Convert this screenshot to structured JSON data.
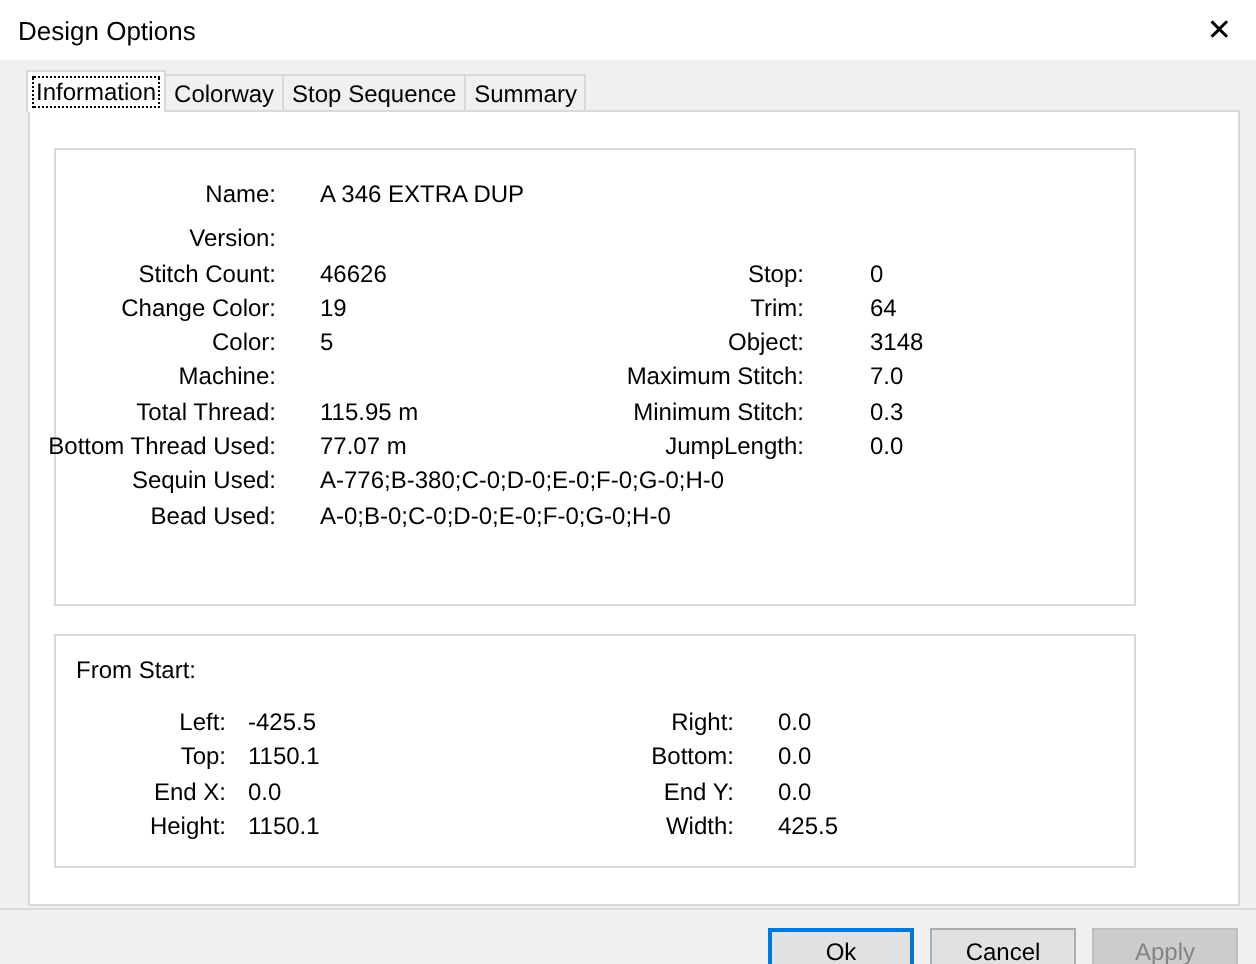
{
  "window": {
    "title": "Design Options",
    "close": "✕"
  },
  "tabs": [
    {
      "label": "Information",
      "selected": true
    },
    {
      "label": "Colorway",
      "selected": false
    },
    {
      "label": "Stop Sequence",
      "selected": false
    },
    {
      "label": "Summary",
      "selected": false
    }
  ],
  "information": {
    "rows": [
      {
        "label": "Name:",
        "value": "A 346 EXTRA DUP"
      },
      {
        "label": "Version:"
      },
      {
        "label": "Stitch Count:",
        "value": "46626",
        "stat_label": "Stop:",
        "stat_value": "0"
      },
      {
        "label": "Change Color:",
        "value": "19",
        "stat_label": "Trim:",
        "stat_value": "64"
      },
      {
        "label": "Color:",
        "value": "5",
        "stat_label": "Object:",
        "stat_value": "3148"
      },
      {
        "label": "Machine:",
        "stat_label": "Maximum Stitch:",
        "stat_value": "7.0"
      },
      {
        "label": "Total Thread:",
        "value": "115.95 m",
        "stat_label": "Minimum Stitch:",
        "stat_value": "0.3"
      },
      {
        "label": "Bottom Thread Used:",
        "value": "77.07 m",
        "stat_label": "JumpLength:",
        "stat_value": "0.0"
      },
      {
        "label": "Sequin Used:",
        "value": "A-776;B-380;C-0;D-0;E-0;F-0;G-0;H-0"
      },
      {
        "label": "Bead Used:",
        "value": "A-0;B-0;C-0;D-0;E-0;F-0;G-0;H-0"
      }
    ]
  },
  "from_start": {
    "heading": "From Start:",
    "rows": [
      {
        "label": "Left:",
        "value": "-425.5",
        "stat_label": "Right:",
        "stat_value": "0.0"
      },
      {
        "label": "Top:",
        "value": "1150.1",
        "stat_label": "Bottom:",
        "stat_value": "0.0"
      },
      {
        "label": "End X:",
        "value": "0.0",
        "stat_label": "End Y:",
        "stat_value": "0.0"
      },
      {
        "label": "Height:",
        "value": "1150.1",
        "stat_label": "Width:",
        "stat_value": "425.5"
      }
    ]
  },
  "buttons": [
    {
      "label": "Ok",
      "default": true,
      "disabled": false
    },
    {
      "label": "Cancel",
      "default": false,
      "disabled": false
    },
    {
      "label": "Apply",
      "default": false,
      "disabled": true
    }
  ]
}
